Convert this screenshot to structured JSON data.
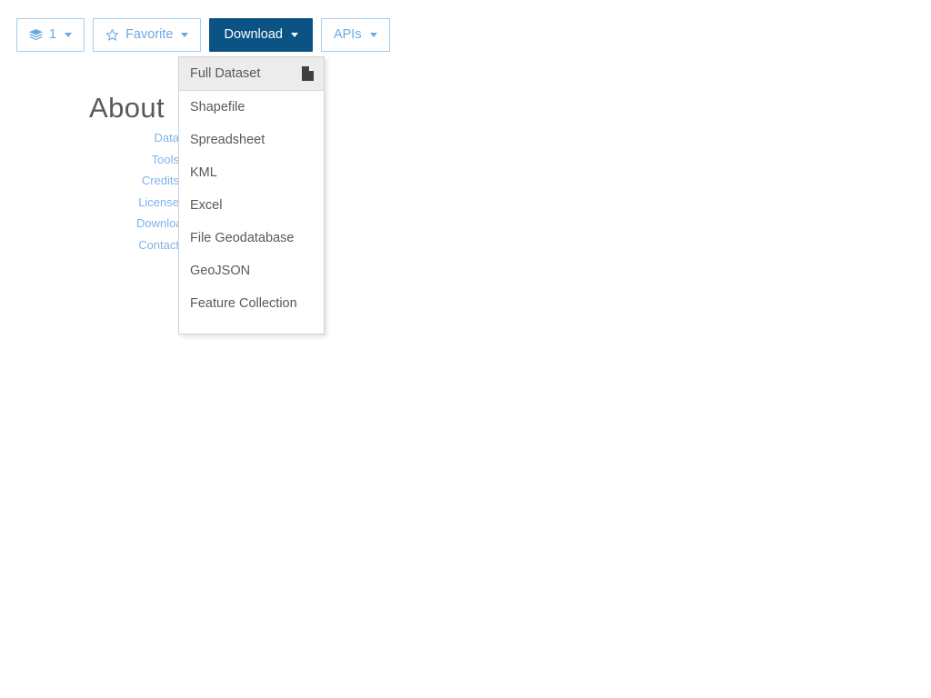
{
  "toolbar": {
    "layers_button": {
      "icon": "layers-icon",
      "count": "1",
      "caret": true
    },
    "favorite_button": {
      "icon": "star-icon",
      "label": "Favorite",
      "caret": true
    },
    "download_button": {
      "label": "Download",
      "caret": true,
      "active": true
    },
    "apis_button": {
      "label": "APIs",
      "caret": true
    }
  },
  "page": {
    "heading": "About",
    "obscured_links": [
      "Data",
      "Tools",
      "Credits",
      "License",
      "Download",
      "Contact"
    ]
  },
  "download_menu": {
    "header": {
      "label": "Full Dataset",
      "icon": "file-icon"
    },
    "items": [
      {
        "label": "Shapefile"
      },
      {
        "label": "Spreadsheet"
      },
      {
        "label": "KML"
      },
      {
        "label": "Excel"
      },
      {
        "label": "File Geodatabase"
      },
      {
        "label": "GeoJSON"
      },
      {
        "label": "Feature Collection"
      }
    ]
  },
  "colors": {
    "accent_blue": "#6aaae4",
    "border_blue": "#a5cdee",
    "primary_navy": "#0b5285",
    "text_gray": "#58595b",
    "menu_header_bg": "#ececec",
    "menu_border": "#d3d3d3"
  }
}
